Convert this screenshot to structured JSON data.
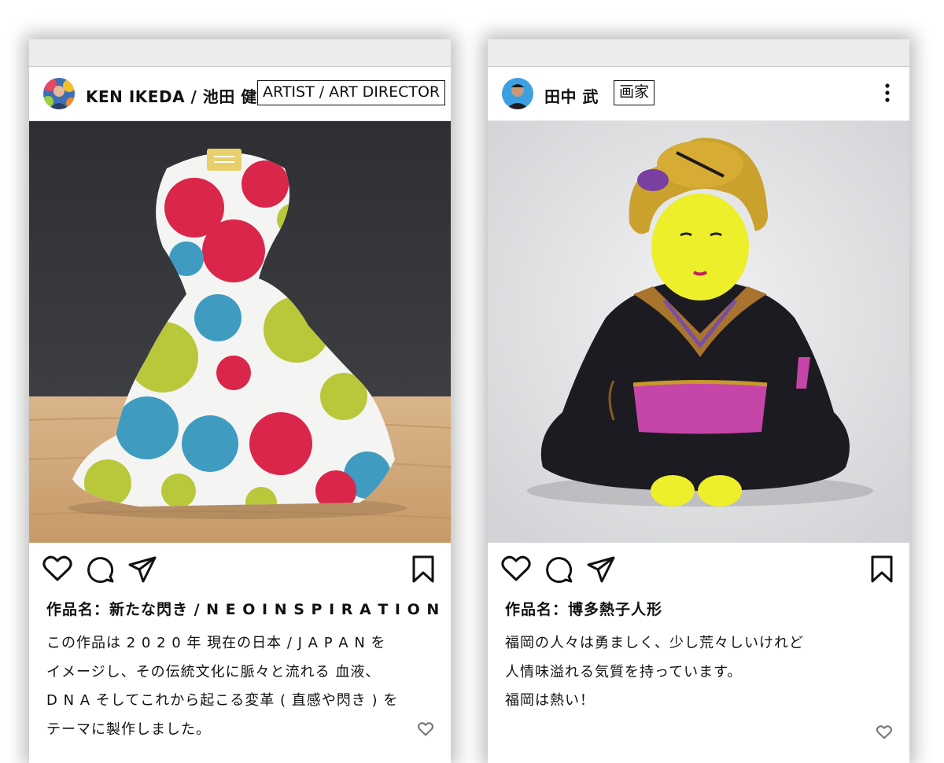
{
  "posts": [
    {
      "username": "KEN IKEDA / 池田 健",
      "role": "ARTIST / ART DIRECTOR",
      "title": "作品名：新たな閃き / N E O  I N S P I R A T I O N",
      "caption": [
        "この作品は 2 0 2 0 年 現在の日本 / J A P A N を",
        "イメージし、その伝統文化に脈々と流れる 血液、",
        "D N A そしてこれから起こる変革 ( 直感や閃き ) を",
        "テーマに製作しました。"
      ],
      "icons": [
        "like-heart-icon",
        "comment-icon",
        "share-icon",
        "bookmark-icon"
      ]
    },
    {
      "username": "田中 武",
      "role": "画家",
      "title": "作品名：博多熱子人形",
      "caption": [
        "福岡の人々は勇ましく、少し荒々しいけれど",
        "人情味溢れる気質を持っています。",
        "福岡は熱い！"
      ],
      "icons": [
        "like-heart-icon",
        "comment-icon",
        "share-icon",
        "bookmark-icon",
        "more-options-icon"
      ]
    }
  ]
}
